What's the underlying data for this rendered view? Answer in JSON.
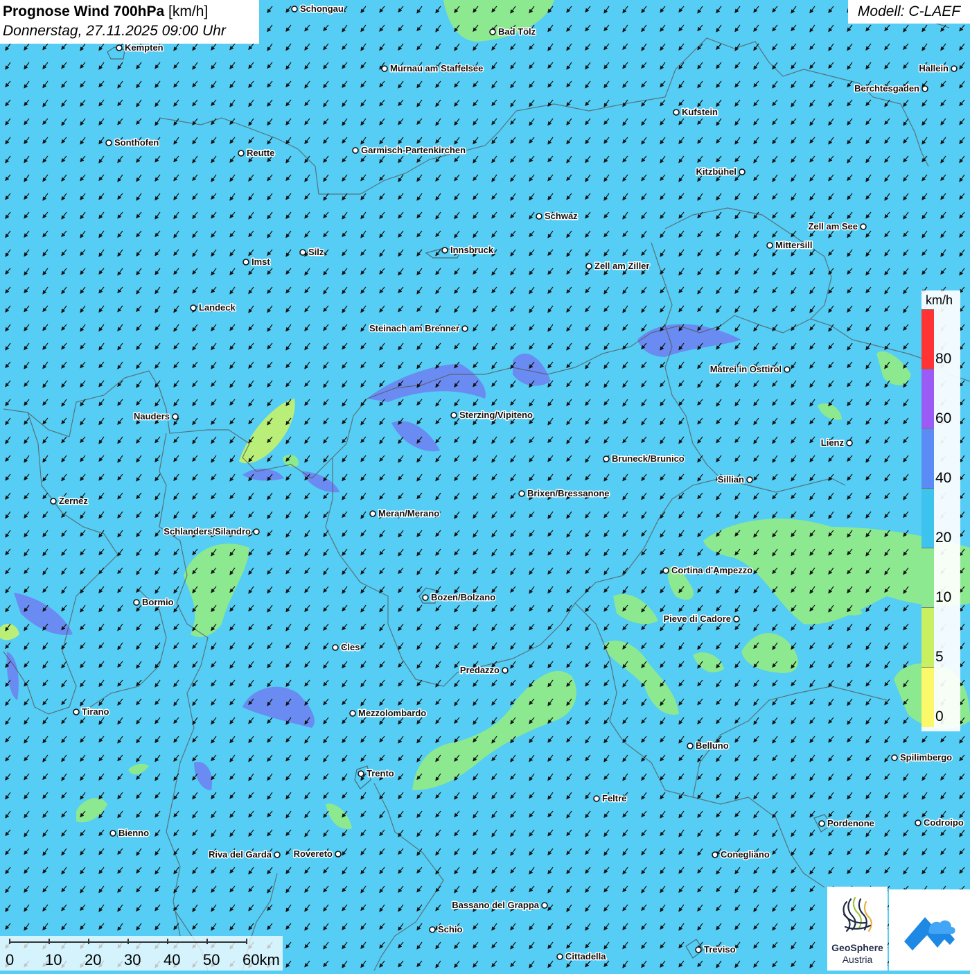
{
  "header": {
    "title_bold": "Prognose Wind 700hPa",
    "title_unit": "[km/h]",
    "datetime": "Donnerstag, 27.11.2025 09:00 Uhr"
  },
  "model": {
    "label": "Modell: C-LAEF"
  },
  "legend": {
    "unit": "km/h",
    "labels": [
      "80",
      "60",
      "40",
      "20",
      "10",
      "5",
      "0"
    ],
    "colors": [
      "#ff3333",
      "#9a5cf5",
      "#5b8cf5",
      "#3cc3ee",
      "#8ce98f",
      "#c8f060",
      "#fbf96a"
    ]
  },
  "scale_bar": {
    "labels": [
      "0",
      "10",
      "20",
      "30",
      "40",
      "50",
      "60km"
    ]
  },
  "logos": {
    "geosphere_name": "GeoSphere",
    "geosphere_sub": "Austria",
    "app_icon": "mountain-cloud-icon",
    "geosphere_icon": "geosphere-waves-icon"
  },
  "wind": {
    "prevailing_direction": "NE",
    "arrow_style": "black arrows with white outline"
  },
  "cities": [
    {
      "name": "Schongau"
    },
    {
      "name": "Kempten"
    },
    {
      "name": "Bad Tölz"
    },
    {
      "name": "Murnau am Staffelsee"
    },
    {
      "name": "Hallein"
    },
    {
      "name": "Berchtesgaden"
    },
    {
      "name": "Kufstein"
    },
    {
      "name": "Sonthofen"
    },
    {
      "name": "Reutte"
    },
    {
      "name": "Garmisch-Partenkirchen"
    },
    {
      "name": "Kitzbühel"
    },
    {
      "name": "Schwaz"
    },
    {
      "name": "Zell am See"
    },
    {
      "name": "Mittersill"
    },
    {
      "name": "Imst"
    },
    {
      "name": "Silz"
    },
    {
      "name": "Innsbruck"
    },
    {
      "name": "Zell am Ziller"
    },
    {
      "name": "Landeck"
    },
    {
      "name": "Steinach am Brenner"
    },
    {
      "name": "Matrei in Osttirol"
    },
    {
      "name": "Nauders"
    },
    {
      "name": "Sterzing/Vipiteno"
    },
    {
      "name": "Lienz"
    },
    {
      "name": "Bruneck/Brunico"
    },
    {
      "name": "Sillian"
    },
    {
      "name": "Brixen/Bressanone"
    },
    {
      "name": "Zernez"
    },
    {
      "name": "Meran/Merano"
    },
    {
      "name": "Schlanders/Silandro"
    },
    {
      "name": "Cortina d'Ampezzo"
    },
    {
      "name": "Bozen/Bolzano"
    },
    {
      "name": "Bormio"
    },
    {
      "name": "Pieve di Cadore"
    },
    {
      "name": "Cles"
    },
    {
      "name": "Predazzo"
    },
    {
      "name": "Tirano"
    },
    {
      "name": "Mezzolombardo"
    },
    {
      "name": "Belluno"
    },
    {
      "name": "Spilimbergo"
    },
    {
      "name": "Trento"
    },
    {
      "name": "Feltre"
    },
    {
      "name": "Pordenone"
    },
    {
      "name": "Codroipo"
    },
    {
      "name": "Bienno"
    },
    {
      "name": "Riva del Garda"
    },
    {
      "name": "Rovereto"
    },
    {
      "name": "Conegliano"
    },
    {
      "name": "Bassano del Grappa"
    },
    {
      "name": "Schio"
    },
    {
      "name": "Treviso"
    },
    {
      "name": "Cittadella"
    }
  ]
}
